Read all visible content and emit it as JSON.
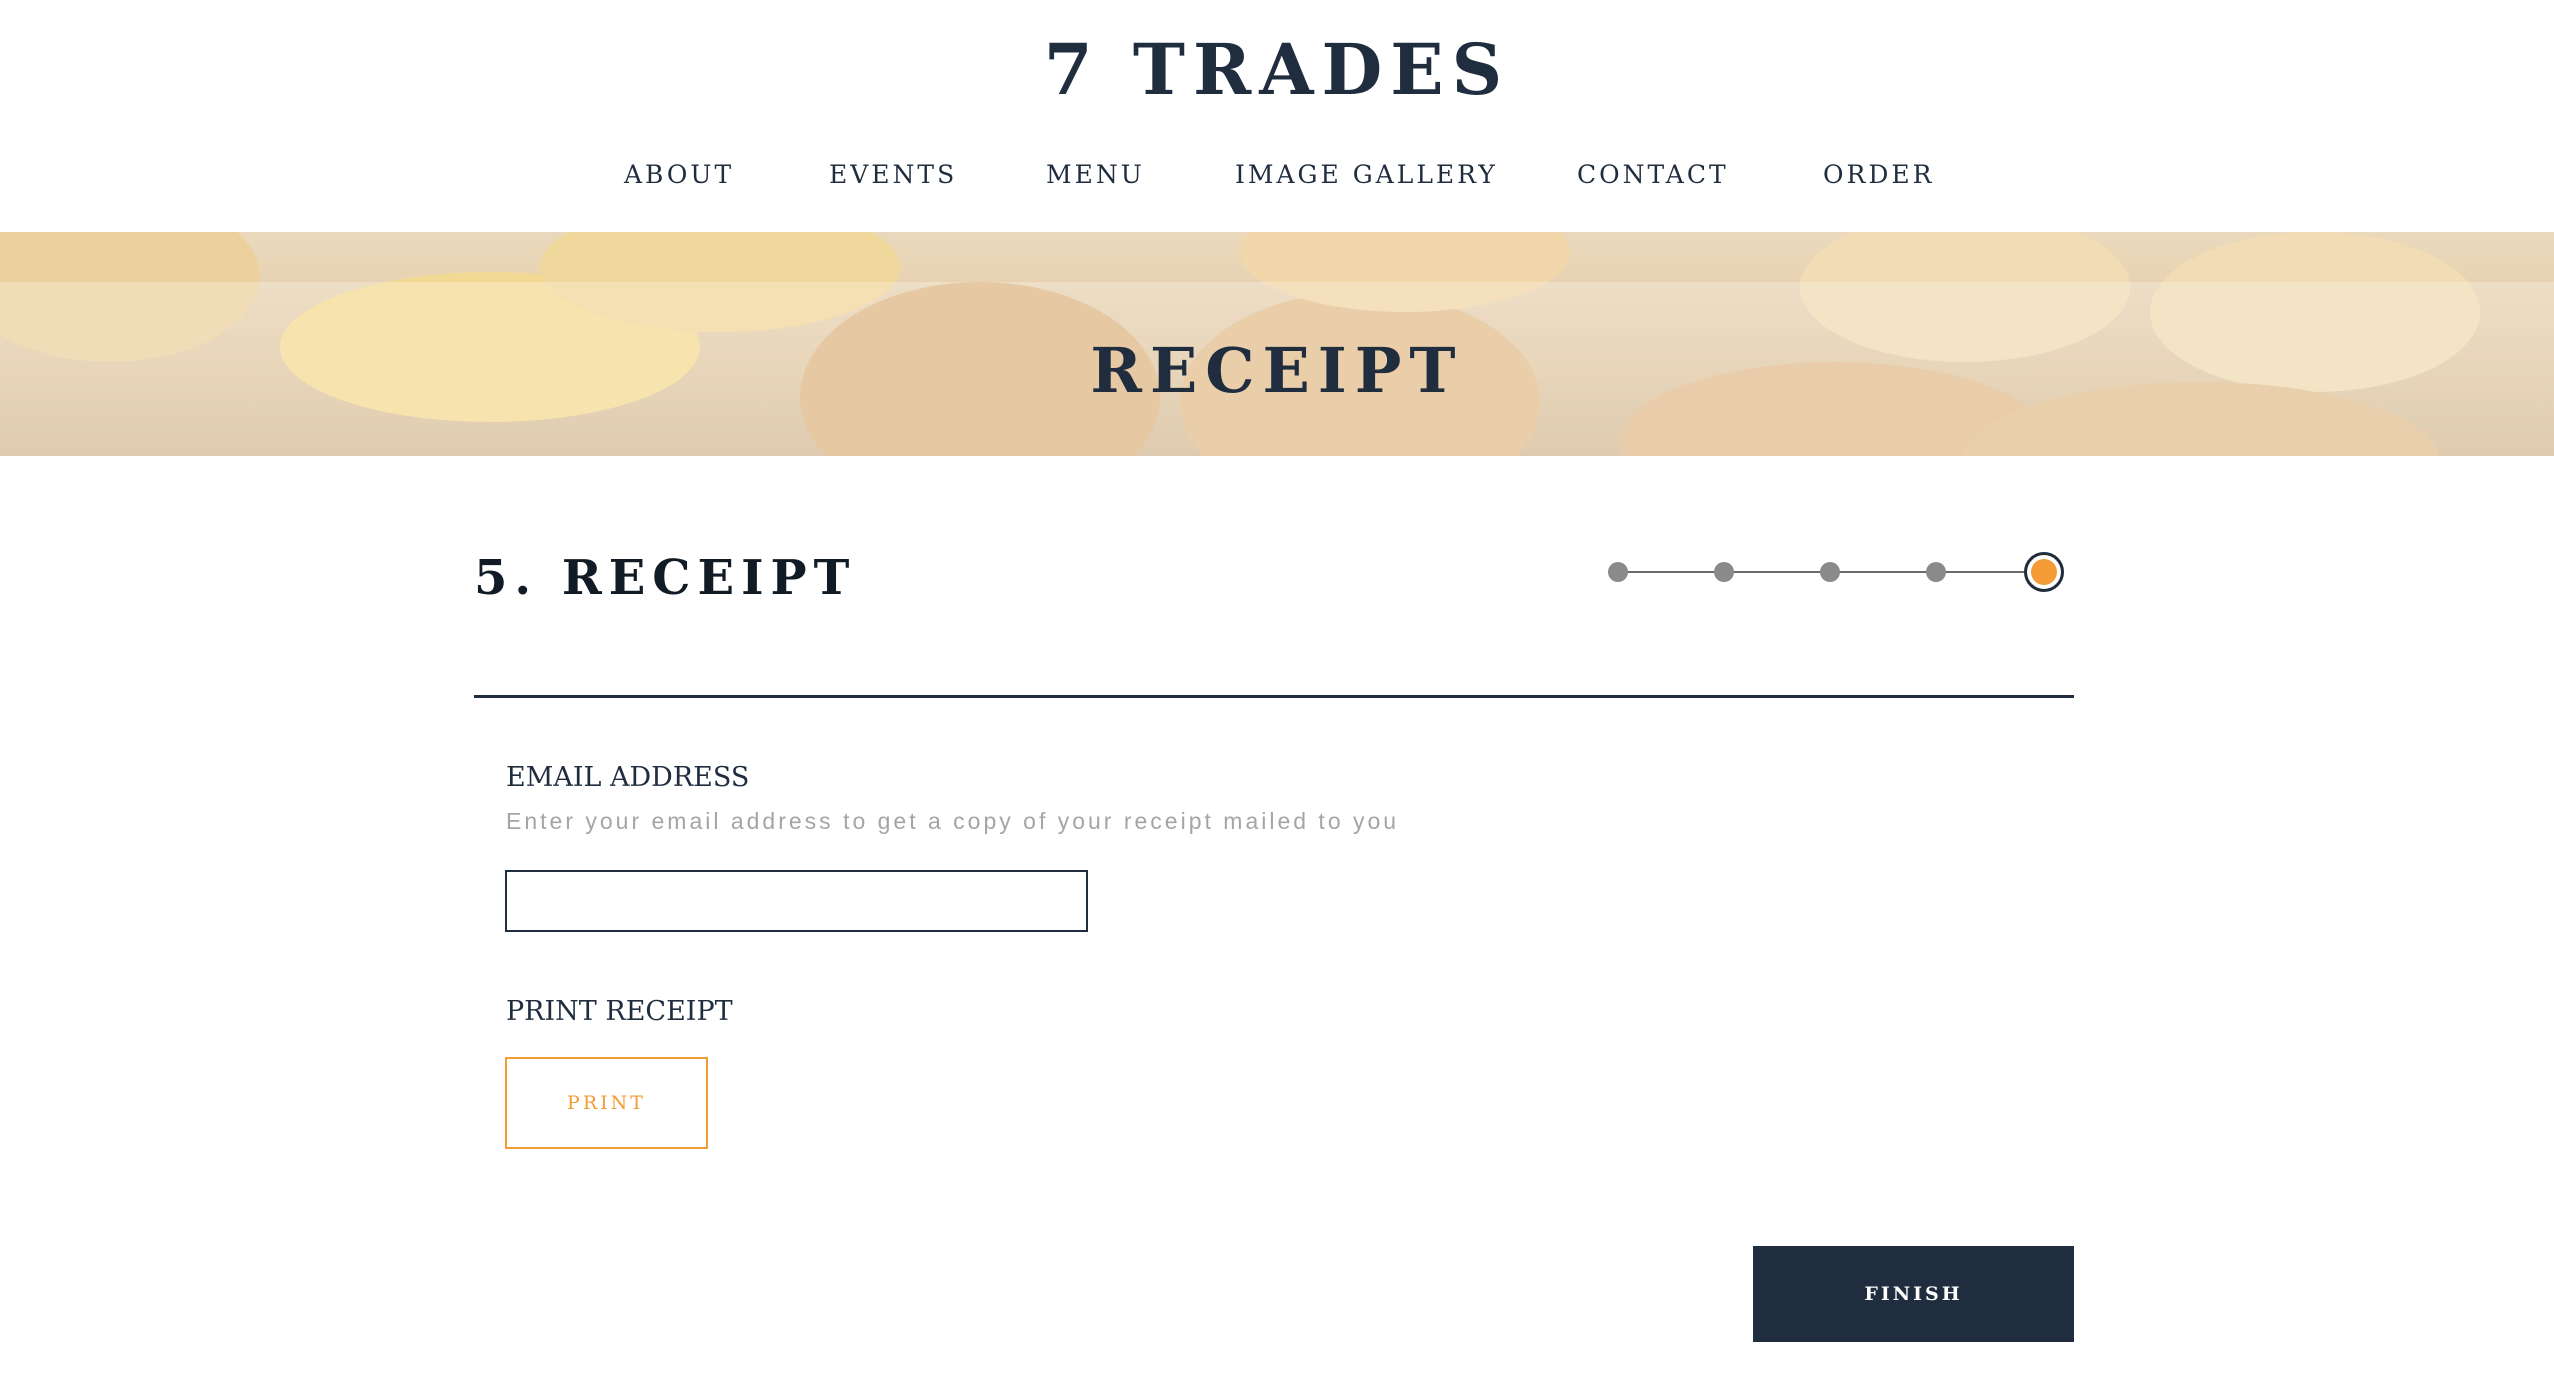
{
  "site": {
    "logo": "7 TRADES"
  },
  "nav": [
    {
      "label": "ABOUT"
    },
    {
      "label": "EVENTS"
    },
    {
      "label": "MENU"
    },
    {
      "label": "IMAGE GALLERY"
    },
    {
      "label": "CONTACT"
    },
    {
      "label": "ORDER"
    }
  ],
  "banner": {
    "title": "RECEIPT"
  },
  "step": {
    "title": "5. RECEIPT",
    "current": 5,
    "total": 5
  },
  "email": {
    "label": "EMAIL ADDRESS",
    "hint": "Enter your email address to get a copy of your receipt mailed to you",
    "value": ""
  },
  "print": {
    "label": "PRINT RECEIPT",
    "button": "PRINT"
  },
  "finish": {
    "button": "FINISH"
  },
  "colors": {
    "navy": "#1f2d3f",
    "accent": "#f39b34",
    "inactive_dot": "#8a8a8a",
    "hint": "#a5a5a5"
  }
}
